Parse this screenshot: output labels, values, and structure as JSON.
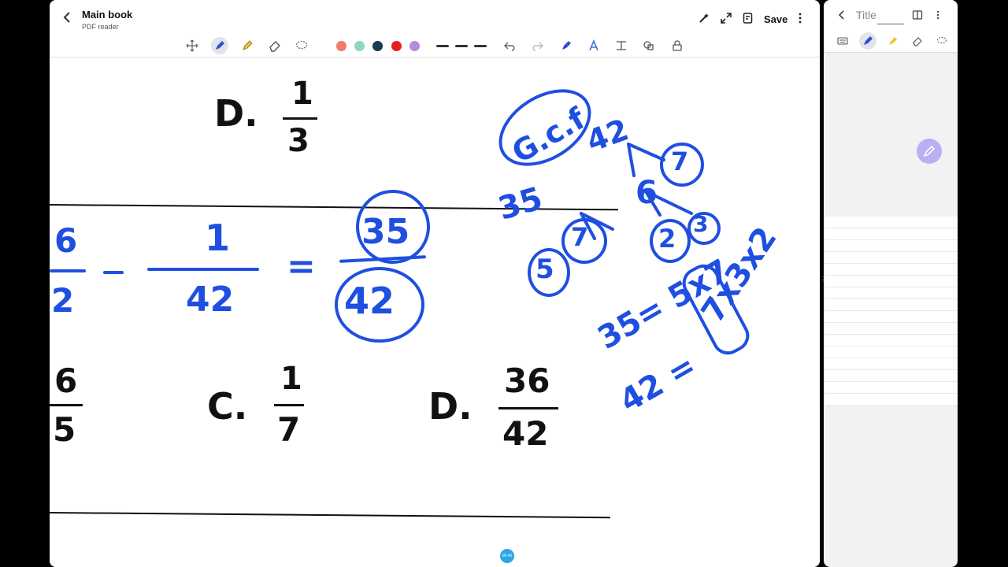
{
  "header": {
    "title": "Main book",
    "subtitle": "PDF reader",
    "save_label": "Save"
  },
  "toolbar": {
    "tools": [
      "move-icon",
      "pen-icon",
      "highlighter-icon",
      "eraser-icon",
      "lasso-icon"
    ],
    "colors": [
      "#f07b6e",
      "#8fd6c4",
      "#1b3a4b",
      "#e61e1e",
      "#b38be0"
    ],
    "right_tools": [
      "undo-icon",
      "redo-icon",
      "pen-settings-icon",
      "text-style-icon",
      "text-box-icon",
      "shapes-icon",
      "lock-icon"
    ]
  },
  "document": {
    "printed": {
      "row1_letter": "D.",
      "row1_num": "1",
      "row1_den": "3",
      "row3_partial_num": "6",
      "row3_partial_den": "5",
      "c_letter": "C.",
      "c_num": "1",
      "c_den": "7",
      "d_letter": "D.",
      "d_num": "36",
      "d_den": "42"
    },
    "ink": {
      "partial_num": "6",
      "partial_den": "2",
      "minus": "–",
      "frac_num": "1",
      "frac_den": "42",
      "equals": "=",
      "result_num": "35",
      "result_den": "42",
      "gcf": "G.c.f",
      "tree_42": "42",
      "tree_7": "7",
      "tree_6": "6",
      "tree_2": "2",
      "tree_3": "3",
      "tree_35": "35",
      "tree_7b": "7",
      "tree_5": "5",
      "eq1": "35= 5x7",
      "eq2": "42 =",
      "eq_side": "7x3x2"
    },
    "badge": "06:46"
  },
  "side_panel": {
    "title": "Title"
  }
}
